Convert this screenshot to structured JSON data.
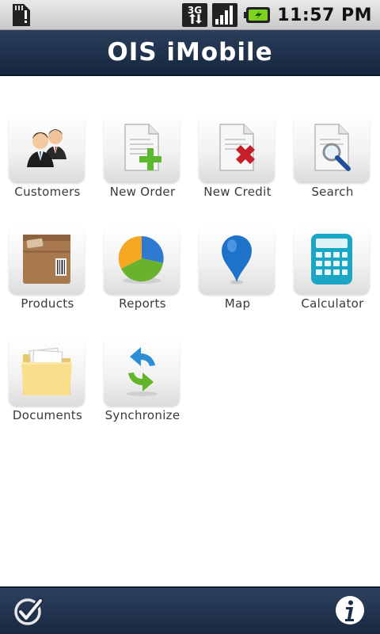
{
  "status_bar": {
    "time": "11:57 PM",
    "network_label": "3G",
    "icons": [
      "sd-card-alert-icon",
      "3g-data-icon",
      "signal-strength-icon",
      "battery-charging-icon"
    ]
  },
  "header": {
    "title": "OIS iMobile"
  },
  "menu": {
    "items": [
      {
        "label": "Customers",
        "icon": "customers-icon"
      },
      {
        "label": "New Order",
        "icon": "new-order-icon"
      },
      {
        "label": "New Credit",
        "icon": "new-credit-icon"
      },
      {
        "label": "Search",
        "icon": "search-icon"
      },
      {
        "label": "Products",
        "icon": "products-icon"
      },
      {
        "label": "Reports",
        "icon": "reports-icon"
      },
      {
        "label": "Map",
        "icon": "map-pin-icon"
      },
      {
        "label": "Calculator",
        "icon": "calculator-icon"
      },
      {
        "label": "Documents",
        "icon": "documents-icon"
      },
      {
        "label": "Synchronize",
        "icon": "synchronize-icon"
      }
    ]
  },
  "bottom_bar": {
    "left_icon": "checkmark-icon",
    "right_icon": "info-icon"
  },
  "colors": {
    "header_bg": "#1f3350",
    "title_text": "#ffffff",
    "label_text": "#3a3a3a"
  }
}
